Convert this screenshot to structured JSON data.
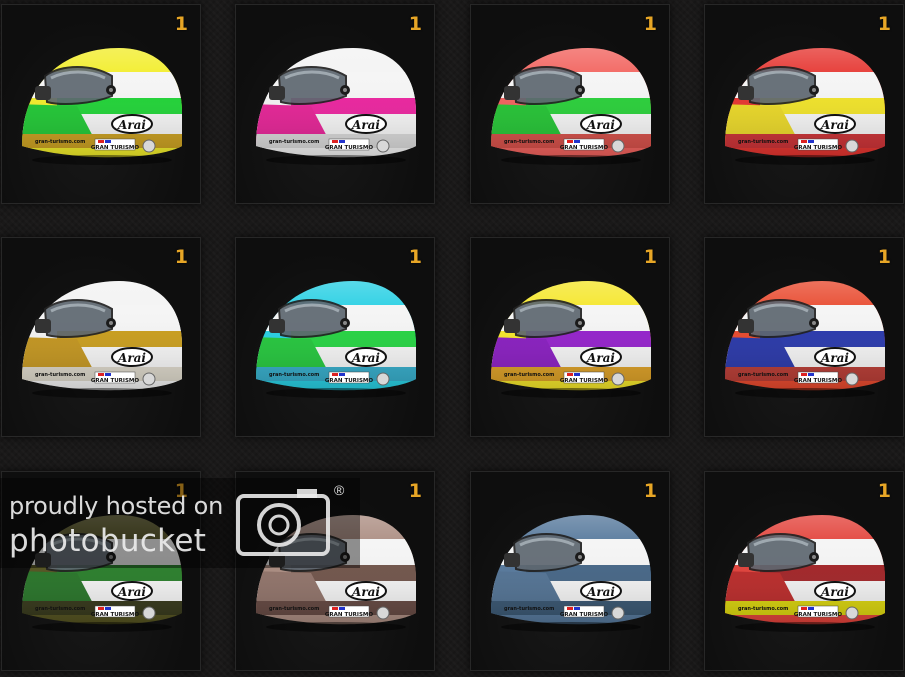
{
  "helmets": [
    {
      "count": "1",
      "colors": {
        "top": "#f1ec1f",
        "stripe": "#16d12d",
        "chin": "#15c42a",
        "bottom": "#c79a14"
      }
    },
    {
      "count": "1",
      "colors": {
        "top": "#f2f2f2",
        "stripe": "#ea1a9a",
        "chin": "#e31890",
        "bottom": "#d6d6d6"
      }
    },
    {
      "count": "1",
      "colors": {
        "top": "#f15a55",
        "stripe": "#1fcd30",
        "chin": "#19c02a",
        "bottom": "#d2453e"
      }
    },
    {
      "count": "1",
      "colors": {
        "top": "#e42a25",
        "stripe": "#efe11e",
        "chin": "#e8d51c",
        "bottom": "#c7262a"
      }
    },
    {
      "count": "1",
      "colors": {
        "top": "#f2f2f2",
        "stripe": "#c79912",
        "chin": "#c09014",
        "bottom": "#d9d4c6"
      }
    },
    {
      "count": "1",
      "colors": {
        "top": "#1dcde2",
        "stripe": "#1bd139",
        "chin": "#19c333",
        "bottom": "#2aa7c6"
      }
    },
    {
      "count": "1",
      "colors": {
        "top": "#f4e51f",
        "stripe": "#8f17c9",
        "chin": "#8312bd",
        "bottom": "#d99a1a"
      }
    },
    {
      "count": "1",
      "colors": {
        "top": "#e74023",
        "stripe": "#1f2fa8",
        "chin": "#1e2da4",
        "bottom": "#b33129"
      }
    },
    {
      "count": "1",
      "colors": {
        "top": "#4c4a15",
        "stripe": "#1f7820",
        "chin": "#1d6e1e",
        "bottom": "#2c2e0f"
      }
    },
    {
      "count": "1",
      "colors": {
        "top": "#a7877b",
        "stripe": "#6a4c42",
        "chin": "#8c6d63",
        "bottom": "#5d3f38"
      }
    },
    {
      "count": "1",
      "colors": {
        "top": "#4e7297",
        "stripe": "#3d5f81",
        "chin": "#4a6c8f",
        "bottom": "#2f4e6b"
      }
    },
    {
      "count": "1",
      "colors": {
        "top": "#e13931",
        "stripe": "#9e1a1d",
        "chin": "#b8201f",
        "bottom": "#d9d300"
      }
    }
  ],
  "helmet_text": {
    "brand": "Arai",
    "badge": "GRAN TURISMO",
    "url": "gran-turismo.com"
  },
  "watermark": {
    "line1": "proudly hosted on",
    "line2": "photobucket",
    "reg": "®"
  }
}
